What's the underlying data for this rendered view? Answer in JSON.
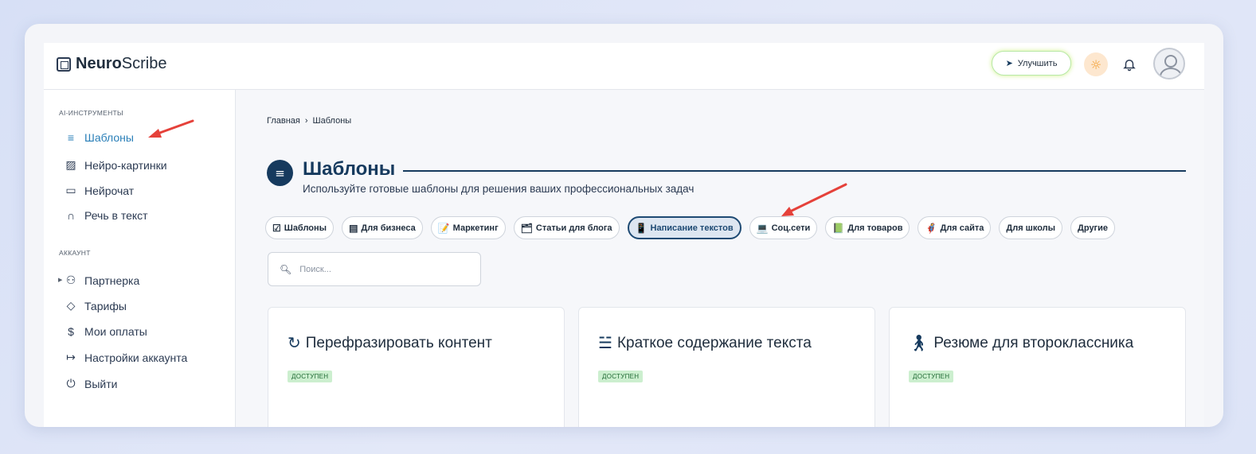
{
  "brand": {
    "bold": "Neuro",
    "regular": "Scribe"
  },
  "header": {
    "upgrade_label": "Улучшить",
    "upgrade_icon": "rocket-icon",
    "theme_icon": "sun-icon",
    "bell_icon": "bell-icon"
  },
  "sidebar": {
    "section_ai": "AI-ИНСТРУМЕНТЫ",
    "ai_items": [
      {
        "label": "Шаблоны",
        "icon": "layers-icon",
        "active": true
      },
      {
        "label": "Нейро-картинки",
        "icon": "image-icon"
      },
      {
        "label": "Нейрочат",
        "icon": "chat-icon"
      },
      {
        "label": "Речь в текст",
        "icon": "headphones-icon"
      }
    ],
    "section_account": "АККАУНТ",
    "account_items": [
      {
        "label": "Партнерка",
        "icon": "users-icon"
      },
      {
        "label": "Тарифы",
        "icon": "tag-icon"
      },
      {
        "label": "Мои оплаты",
        "icon": "dollar-icon"
      },
      {
        "label": "Настройки аккаунта",
        "icon": "logout-arrow-icon"
      },
      {
        "label": "Выйти",
        "icon": "power-icon"
      }
    ]
  },
  "breadcrumb": {
    "home": "Главная",
    "separator": "›",
    "current": "Шаблоны"
  },
  "page": {
    "title": "Шаблоны",
    "subtitle": "Используйте готовые шаблоны для решения ваших профессиональных задач"
  },
  "chips": [
    {
      "icon": "☑",
      "label": "Шаблоны"
    },
    {
      "icon": "▤",
      "label": "Для бизнеса"
    },
    {
      "icon": "📝",
      "label": "Маркетинг"
    },
    {
      "icon": "🗂",
      "label": "Статьи для блога"
    },
    {
      "icon": "📱",
      "label": "Написание текстов",
      "active": true
    },
    {
      "icon": "💻",
      "label": "Соц.сети"
    },
    {
      "icon": "📗",
      "label": "Для товаров"
    },
    {
      "icon": "🦸",
      "label": "Для сайта"
    },
    {
      "icon": "",
      "label": "Для школы"
    },
    {
      "icon": "",
      "label": "Другие"
    }
  ],
  "search": {
    "placeholder": "Поиск..."
  },
  "cards": [
    {
      "icon": "refresh-icon",
      "title": "Перефразировать контент",
      "badge": "ДОСТУПЕН"
    },
    {
      "icon": "summary-icon",
      "title": "Краткое содержание текста",
      "badge": "ДОСТУПЕН"
    },
    {
      "icon": "person-icon",
      "title": "Резюме для второклассника",
      "badge": "ДОСТУПЕН"
    }
  ],
  "colors": {
    "accent": "#2a7fb8",
    "primary": "#163a5e",
    "badge_bg": "#ccefcf",
    "arrow": "#e5413a"
  }
}
